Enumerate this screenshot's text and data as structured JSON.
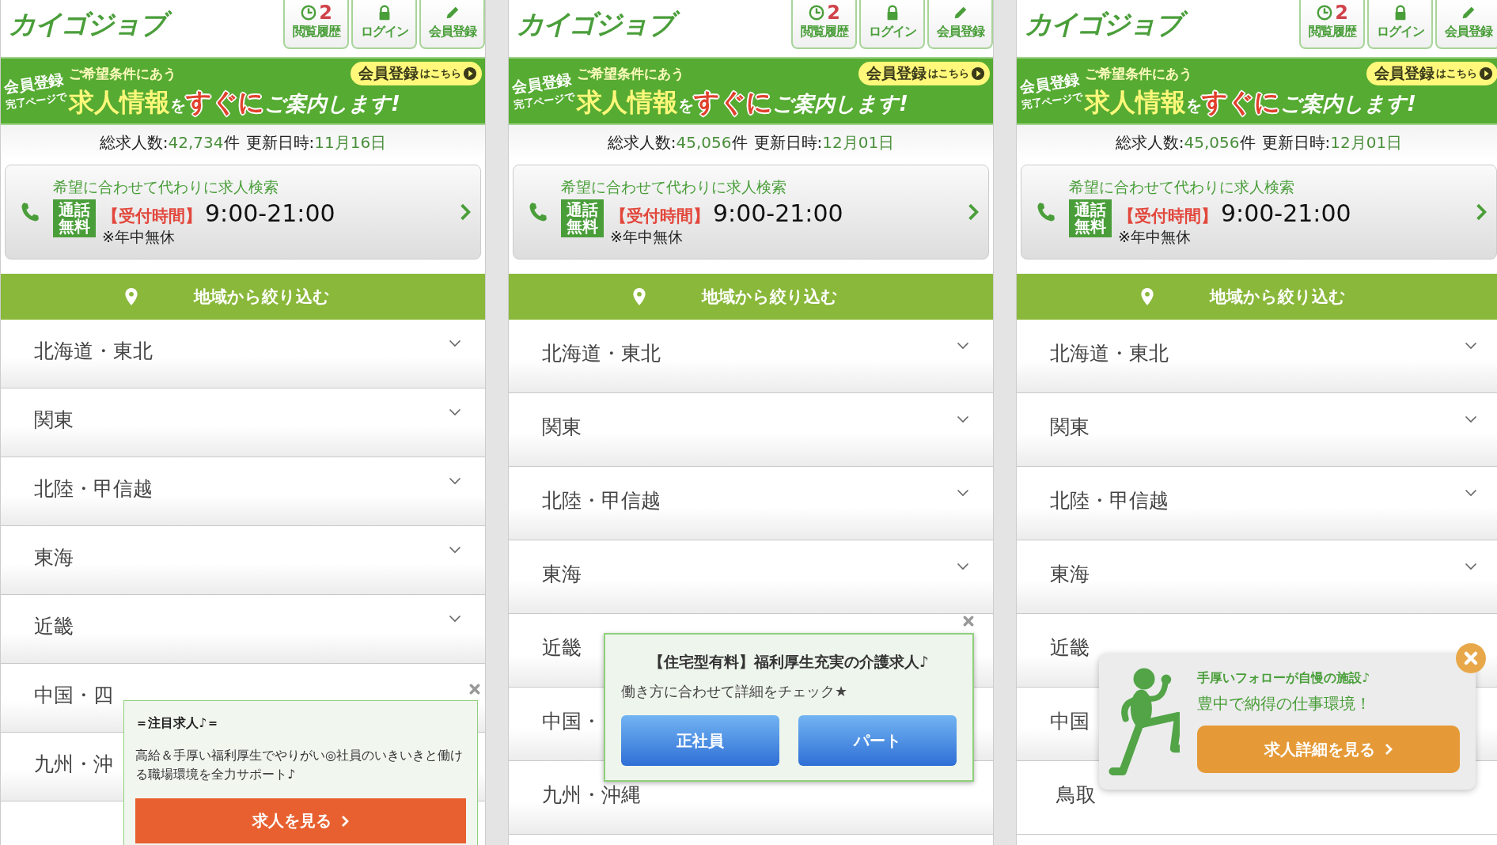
{
  "panels": [
    {
      "logo": "カイゴジョブ",
      "nav": [
        {
          "kind": "history",
          "count": "2",
          "label": "閲覧履歴"
        },
        {
          "kind": "login",
          "label": "ログイン"
        },
        {
          "kind": "register",
          "label": "会員登録"
        }
      ],
      "banner": {
        "lead": "会員登録",
        "lead_sub": "完了ページで",
        "intro": "ご希望条件にあう",
        "headline": [
          {
            "text": "求人情報",
            "kind": "key"
          },
          {
            "text": "を",
            "kind": "particle"
          },
          {
            "text": "すぐに",
            "kind": "accent"
          },
          {
            "text": "ご案内します!",
            "kind": "plain"
          }
        ],
        "cta_main": "会員登録",
        "cta_sub": "はこちら"
      },
      "stats": {
        "count_label": "総求人数:",
        "count": "42,734",
        "count_unit": "件",
        "updated_label": "更新日時:",
        "updated": "11月16日"
      },
      "call": {
        "lead": "希望に合わせて代わりに求人検索",
        "badge": "通話無料",
        "hours_label": "【受付時間】",
        "hours": "9:00-21:00",
        "note": "※年中無休"
      },
      "filter_title": "地域から絞り込む",
      "regions": [
        {
          "label": "北海道・東北",
          "chevron": true
        },
        {
          "label": "関東",
          "chevron": true
        },
        {
          "label": "北陸・甲信越",
          "chevron": true
        },
        {
          "label": "東海",
          "chevron": true
        },
        {
          "label": "近畿",
          "chevron": true
        },
        {
          "label": "中国・四",
          "chevron": false
        },
        {
          "label": "九州・沖",
          "chevron": false
        }
      ],
      "popup": {
        "kind": "notice",
        "title": "＝注目求人♪＝",
        "body": "高給＆手厚い福利厚生でやりがい◎社員のいきいきと働ける職場環境を全力サポート♪",
        "buttons": [
          "求人を見る"
        ]
      }
    },
    {
      "logo": "カイゴジョブ",
      "nav": [
        {
          "kind": "history",
          "count": "2",
          "label": "閲覧履歴"
        },
        {
          "kind": "login",
          "label": "ログイン"
        },
        {
          "kind": "register",
          "label": "会員登録"
        }
      ],
      "banner": {
        "lead": "会員登録",
        "lead_sub": "完了ページで",
        "intro": "ご希望条件にあう",
        "headline": [
          {
            "text": "求人情報",
            "kind": "key"
          },
          {
            "text": "を",
            "kind": "particle"
          },
          {
            "text": "すぐに",
            "kind": "accent"
          },
          {
            "text": "ご案内します!",
            "kind": "plain"
          }
        ],
        "cta_main": "会員登録",
        "cta_sub": "はこちら"
      },
      "stats": {
        "count_label": "総求人数:",
        "count": "45,056",
        "count_unit": "件",
        "updated_label": "更新日時:",
        "updated": "12月01日"
      },
      "call": {
        "lead": "希望に合わせて代わりに求人検索",
        "badge": "通話無料",
        "hours_label": "【受付時間】",
        "hours": "9:00-21:00",
        "note": "※年中無休"
      },
      "filter_title": "地域から絞り込む",
      "regions": [
        {
          "label": "北海道・東北",
          "chevron": true
        },
        {
          "label": "関東",
          "chevron": true
        },
        {
          "label": "北陸・甲信越",
          "chevron": true
        },
        {
          "label": "東海",
          "chevron": true
        },
        {
          "label": "近畿",
          "chevron": false
        },
        {
          "label": "中国・",
          "chevron": false
        },
        {
          "label": "九州・沖縄",
          "chevron": false
        }
      ],
      "popup": {
        "kind": "choice",
        "title": "【住宅型有料】福利厚生充実の介護求人♪",
        "body": "働き方に合わせて詳細をチェック★",
        "buttons": [
          "正社員",
          "パート"
        ]
      }
    },
    {
      "logo": "カイゴジョブ",
      "nav": [
        {
          "kind": "history",
          "count": "2",
          "label": "閲覧履歴"
        },
        {
          "kind": "login",
          "label": "ログイン"
        },
        {
          "kind": "register",
          "label": "会員登録"
        }
      ],
      "banner": {
        "lead": "会員登録",
        "lead_sub": "完了ページで",
        "intro": "ご希望条件にあう",
        "headline": [
          {
            "text": "求人情報",
            "kind": "key"
          },
          {
            "text": "を",
            "kind": "particle"
          },
          {
            "text": "すぐに",
            "kind": "accent"
          },
          {
            "text": "ご案内します!",
            "kind": "plain"
          }
        ],
        "cta_main": "会員登録",
        "cta_sub": "はこちら"
      },
      "stats": {
        "count_label": "総求人数:",
        "count": "45,056",
        "count_unit": "件",
        "updated_label": "更新日時:",
        "updated": "12月01日"
      },
      "call": {
        "lead": "希望に合わせて代わりに求人検索",
        "badge": "通話無料",
        "hours_label": "【受付時間】",
        "hours": "9:00-21:00",
        "note": "※年中無休"
      },
      "filter_title": "地域から絞り込む",
      "regions": [
        {
          "label": "北海道・東北",
          "chevron": true
        },
        {
          "label": "関東",
          "chevron": true
        },
        {
          "label": "北陸・甲信越",
          "chevron": true
        },
        {
          "label": "東海",
          "chevron": true
        },
        {
          "label": "近畿",
          "chevron": false
        },
        {
          "label": "中国",
          "chevron": false,
          "children": [
            {
              "label": "鳥取"
            }
          ]
        }
      ],
      "popup": {
        "kind": "figure",
        "title": "手厚いフォローが自慢の施設♪",
        "body": "豊中で納得の仕事環境！",
        "buttons": [
          "求人詳細を見る"
        ]
      }
    }
  ]
}
